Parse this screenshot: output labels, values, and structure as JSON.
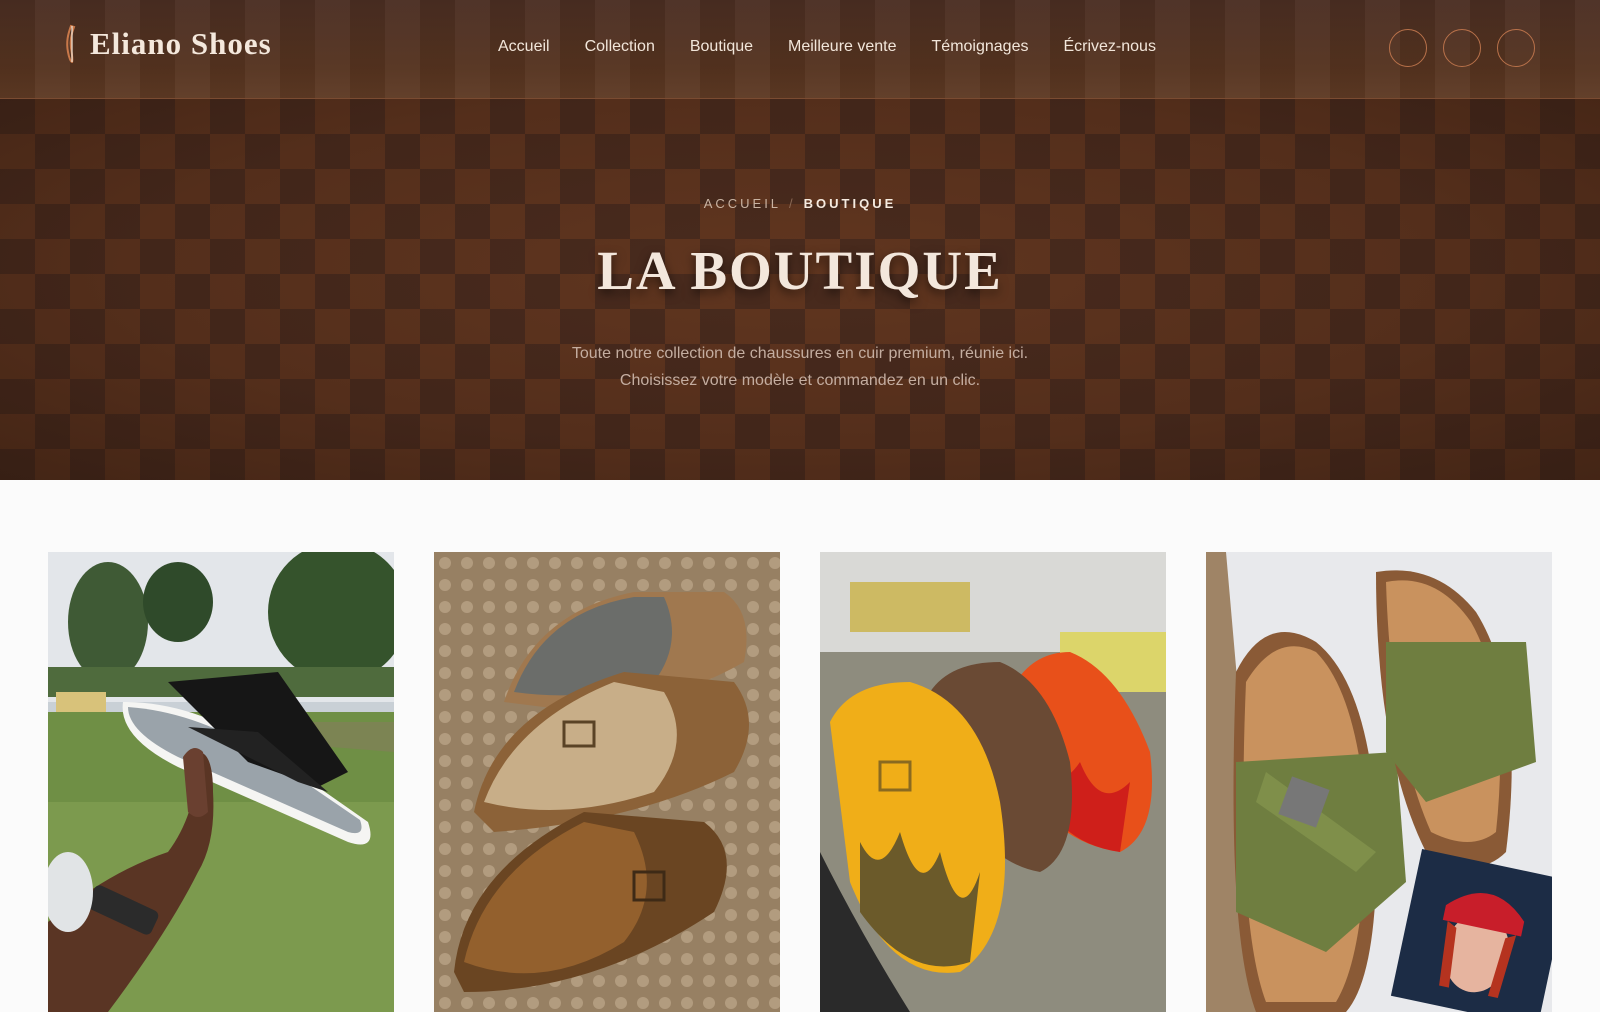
{
  "brand": {
    "name": "Eliano Shoes",
    "icon": "shoe-horn-icon"
  },
  "nav": {
    "items": [
      "Accueil",
      "Collection",
      "Boutique",
      "Meilleure vente",
      "Témoignages",
      "Écrivez-nous"
    ]
  },
  "header_icons": [
    "search-icon",
    "user-icon",
    "cart-icon"
  ],
  "hero": {
    "breadcrumb": {
      "home": "ACCUEIL",
      "separator": "/",
      "current": "BOUTIQUE"
    },
    "title": "LA BOUTIQUE",
    "subtitle_line1": "Toute notre collection de chaussures en cuir premium, réunie ici.",
    "subtitle_line2": "Choisissez votre modèle et commandez en un clic."
  },
  "products": [
    {
      "image": "black-crossover-slide-photo"
    },
    {
      "image": "suede-clogs-trio-photo"
    },
    {
      "image": "flame-suede-clogs-photo"
    },
    {
      "image": "olive-crossover-slides-photo"
    }
  ],
  "colors": {
    "header_bg": "#55331f",
    "checker_dark": "#4f2f21",
    "checker_light": "#6b3c23",
    "accent": "#b8714a",
    "text_light": "#f3e7dc"
  }
}
